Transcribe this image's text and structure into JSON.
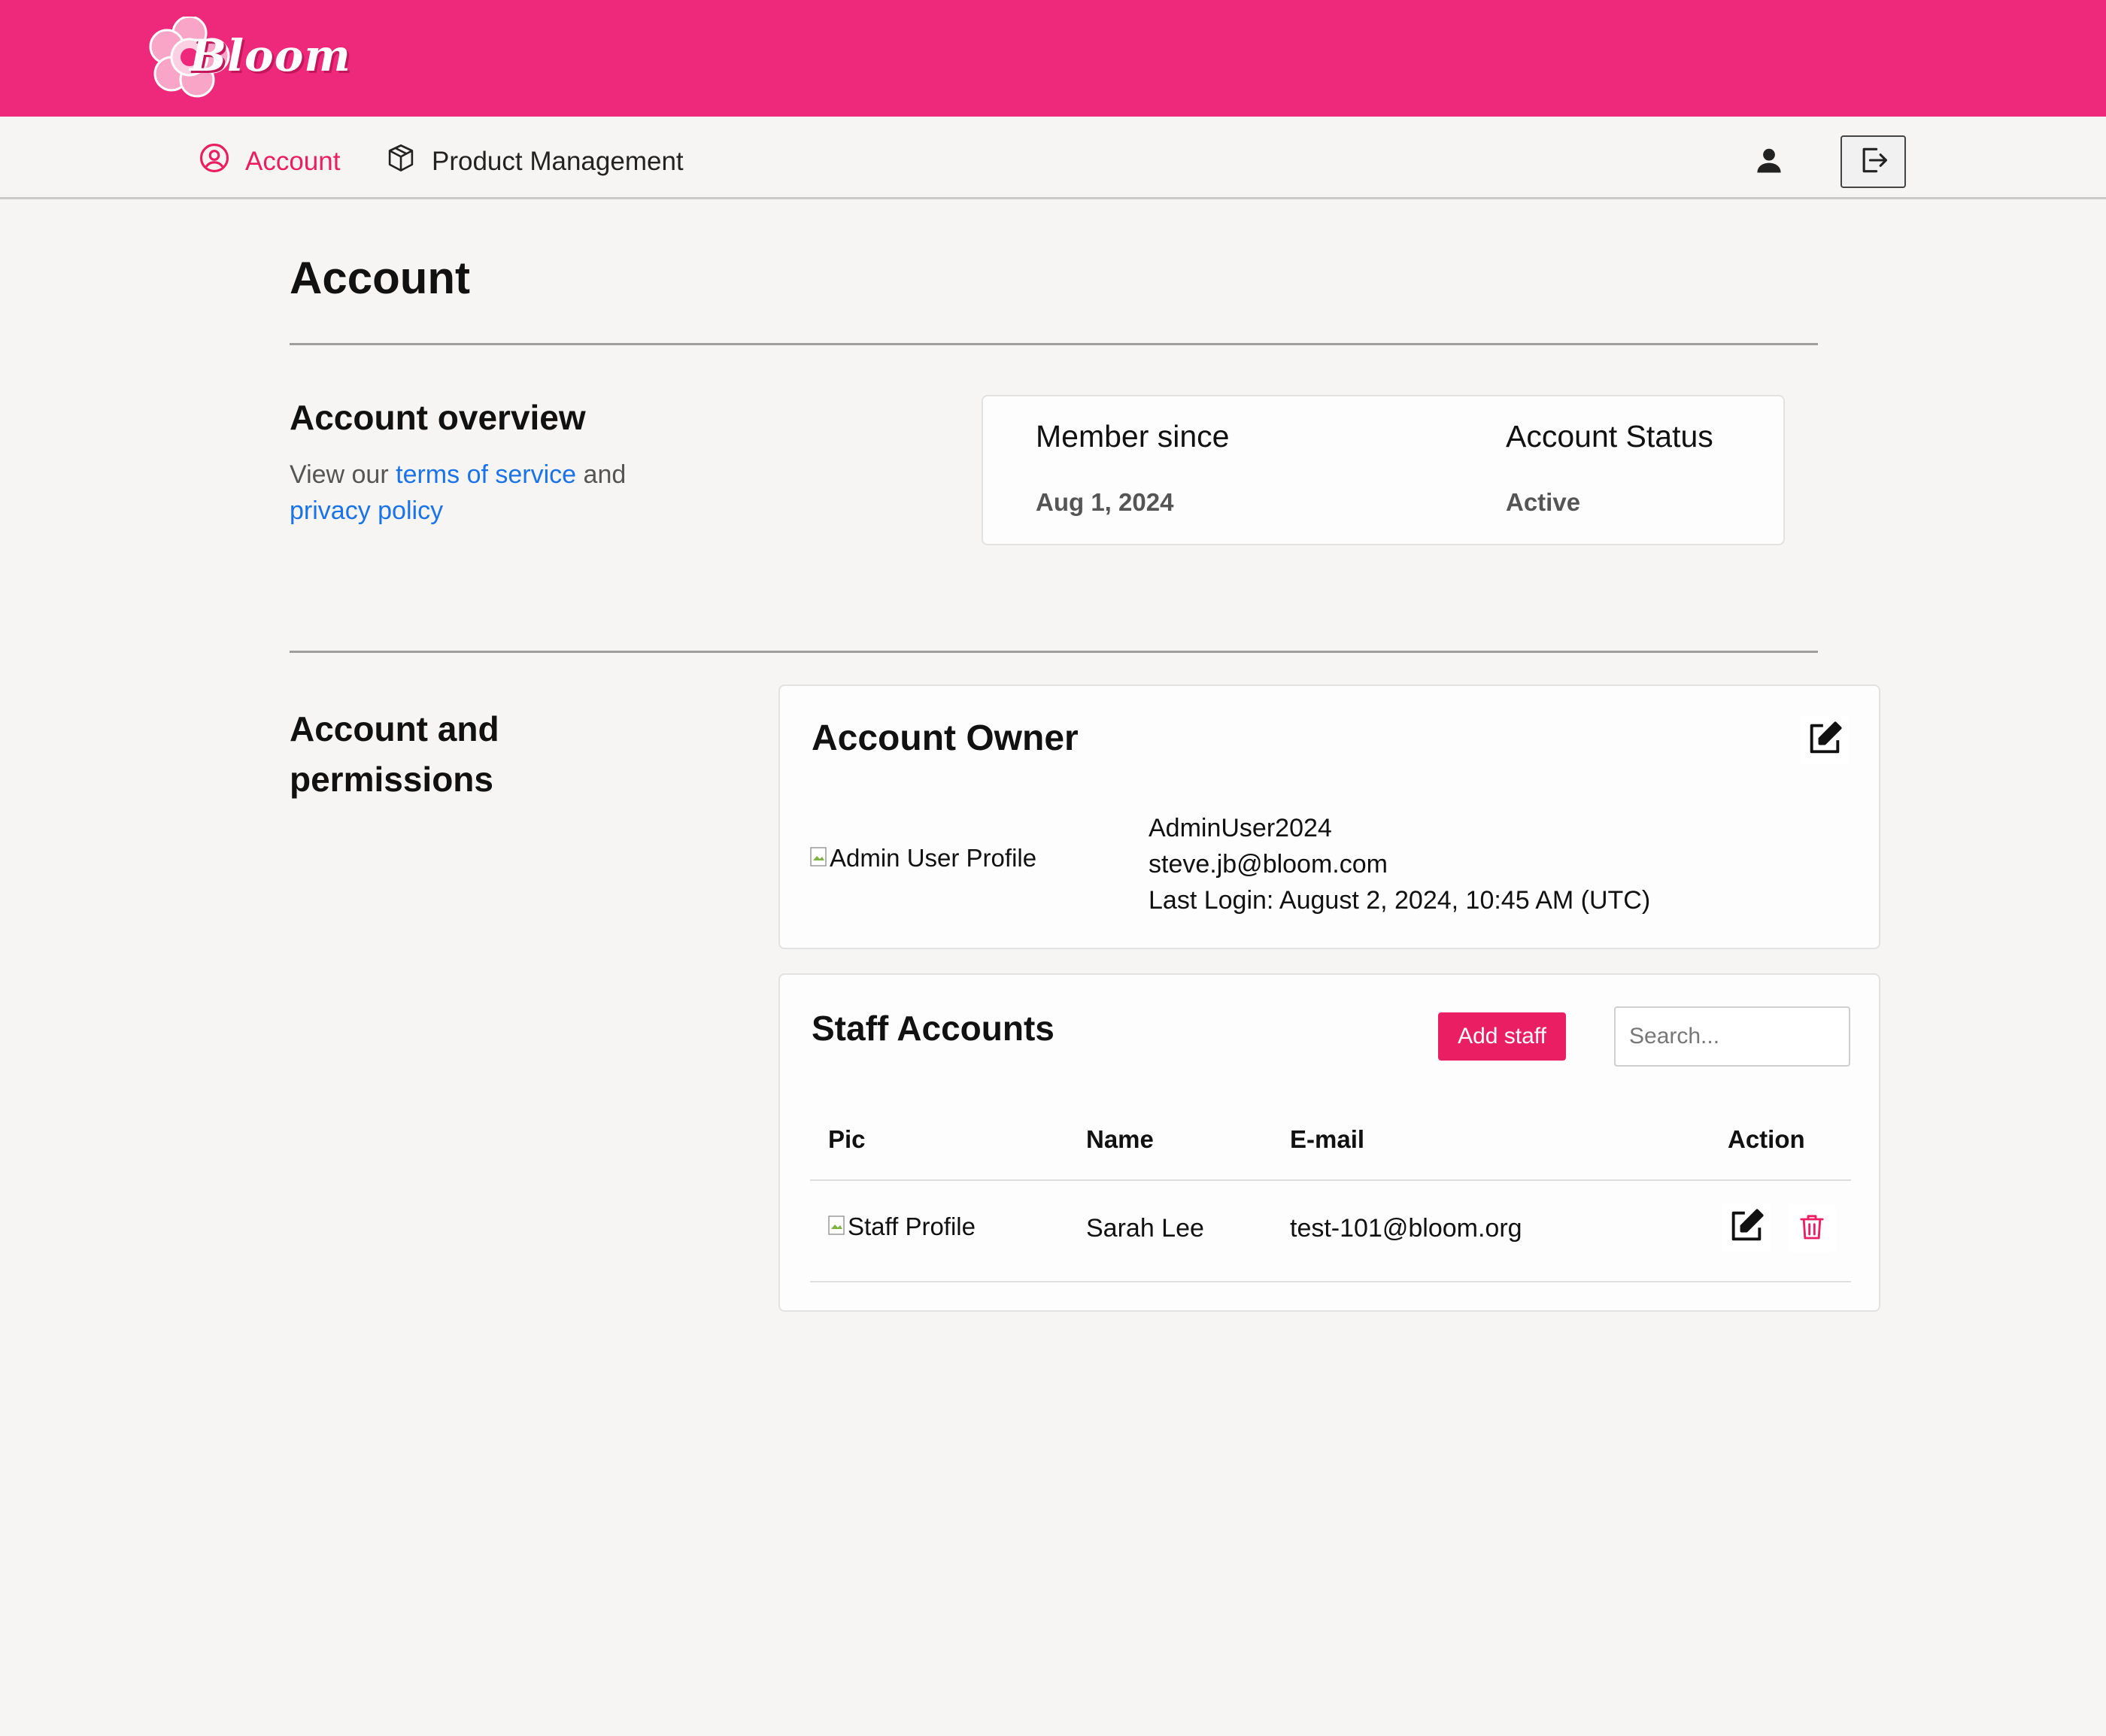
{
  "brand": {
    "name": "Bloom",
    "color": "#ee297c"
  },
  "nav": {
    "items": [
      {
        "label": "Account",
        "icon": "user-circle-icon",
        "active": true
      },
      {
        "label": "Product Management",
        "icon": "box-icon",
        "active": false
      }
    ],
    "user_icon": "person-icon",
    "logout_icon": "logout-icon"
  },
  "page": {
    "title": "Account"
  },
  "overview": {
    "heading": "Account overview",
    "desc_prefix": "View our",
    "terms_link": "terms of service",
    "desc_and": "and",
    "privacy_link": "privacy policy",
    "member_since_label": "Member since",
    "member_since_value": "Aug 1, 2024",
    "status_label": "Account Status",
    "status_value": "Active"
  },
  "permissions": {
    "heading": "Account and permissions",
    "owner": {
      "title": "Account Owner",
      "image_alt": "Admin User Profile",
      "username": "AdminUser2024",
      "email": "steve.jb@bloom.com",
      "last_login": "Last Login: August 2, 2024, 10:45 AM (UTC)"
    },
    "staff": {
      "title": "Staff Accounts",
      "add_button": "Add staff",
      "search_placeholder": "Search...",
      "columns": [
        "Pic",
        "Name",
        "E-mail",
        "Action"
      ],
      "rows": [
        {
          "image_alt": "Staff Profile",
          "name": "Sarah Lee",
          "email": "test-101@bloom.org"
        }
      ]
    }
  },
  "colors": {
    "accent": "#e91e63",
    "link": "#1a73e8",
    "delete": "#e91e63"
  }
}
